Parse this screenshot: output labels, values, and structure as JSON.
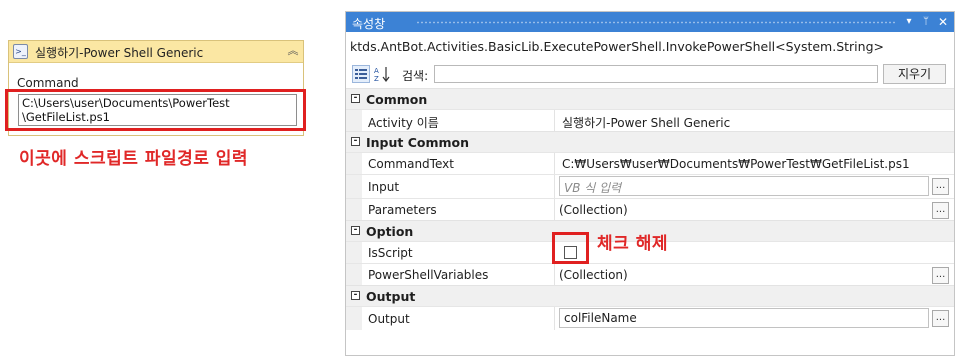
{
  "activity": {
    "title": "실행하기-Power Shell Generic",
    "icon": "powershell-icon",
    "collapse_icon": "chevron-up-double-icon",
    "command_label": "Command",
    "command_value": "C:\\Users\\user\\Documents\\PowerTest\n\\GetFileList.ps1"
  },
  "annotations": {
    "path_note": "이곳에 스크립트 파일경로 입력",
    "checkbox_note": "체크 해제",
    "highlight_color": "#e02020"
  },
  "properties_panel": {
    "title": "속성창",
    "type_name": "ktds.AntBot.Activities.BasicLib.ExecutePowerShell.InvokePowerShell<System.String>",
    "search_label": "검색:",
    "search_value": "",
    "clear_button": "지우기",
    "accent_color": "#3c82d5",
    "categories": [
      {
        "label": "Common",
        "rows": [
          {
            "name": "Activity 이름",
            "value": "실행하기-Power Shell Generic"
          }
        ]
      },
      {
        "label": "Input Common",
        "rows": [
          {
            "name": "CommandText",
            "value": "C:₩Users₩user₩Documents₩PowerTest₩GetFileList.ps1"
          },
          {
            "name": "Input",
            "placeholder": "VB 식 입력"
          },
          {
            "name": "Parameters",
            "value": "(Collection)"
          }
        ]
      },
      {
        "label": "Option",
        "rows": [
          {
            "name": "IsScript",
            "checked": false
          },
          {
            "name": "PowerShellVariables",
            "value": "(Collection)"
          }
        ]
      },
      {
        "label": "Output",
        "rows": [
          {
            "name": "Output",
            "value": "colFileName"
          }
        ]
      }
    ]
  }
}
